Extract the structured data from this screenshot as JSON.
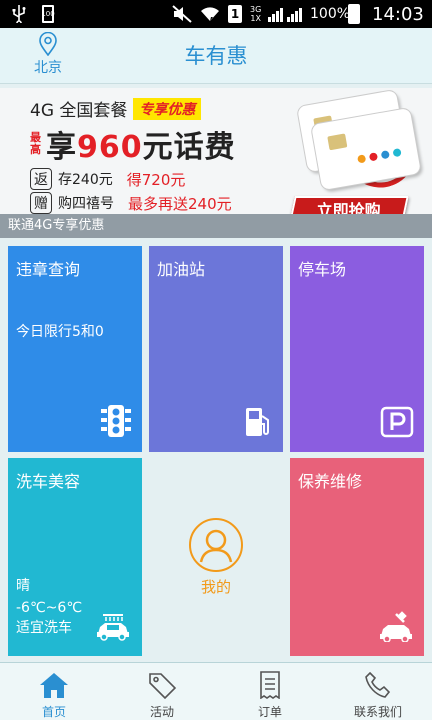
{
  "status_bar": {
    "battery_small_label": "100",
    "network_label_top": "3G",
    "network_label_bottom": "1X",
    "sim_label": "1",
    "battery_pct": "100%",
    "time": "14:03"
  },
  "header": {
    "city": "北京",
    "title": "车有惠"
  },
  "banner": {
    "line1": "4G 全国套餐",
    "tag": "专享优惠",
    "prefix": "最高",
    "big_pre": "享",
    "big_num": "960",
    "big_post": "元话费",
    "row1_chip": "返",
    "row1_text": "存240元",
    "row1_red": "得720元",
    "row2_chip": "赠",
    "row2_text": "购四禧号",
    "row2_red": "最多再送240元",
    "buy_label": "立即抢购"
  },
  "strip_label": "联通4G专享优惠",
  "tiles": {
    "weizhang": {
      "name": "违章查询",
      "sub": "今日限行5和0"
    },
    "gas": {
      "name": "加油站"
    },
    "park": {
      "name": "停车场"
    },
    "wash": {
      "name": "洗车美容",
      "weather": "晴",
      "temp": "-6℃~6℃",
      "advice": "适宜洗车"
    },
    "repair": {
      "name": "保养维修"
    },
    "mine": {
      "name": "我的"
    }
  },
  "bottom_nav": [
    {
      "label": "首页",
      "icon": "home-icon",
      "active": true
    },
    {
      "label": "活动",
      "icon": "tag-icon",
      "active": false
    },
    {
      "label": "订单",
      "icon": "receipt-icon",
      "active": false
    },
    {
      "label": "联系我们",
      "icon": "phone-icon",
      "active": false
    }
  ],
  "colors": {
    "accent": "#2a8fd1",
    "orange": "#f29a1a",
    "tile_blue": "#2f8ce8",
    "tile_indigo": "#6c76d9",
    "tile_purple": "#8b5de0",
    "tile_cyan": "#21b8d2",
    "tile_pink": "#e8617a"
  }
}
